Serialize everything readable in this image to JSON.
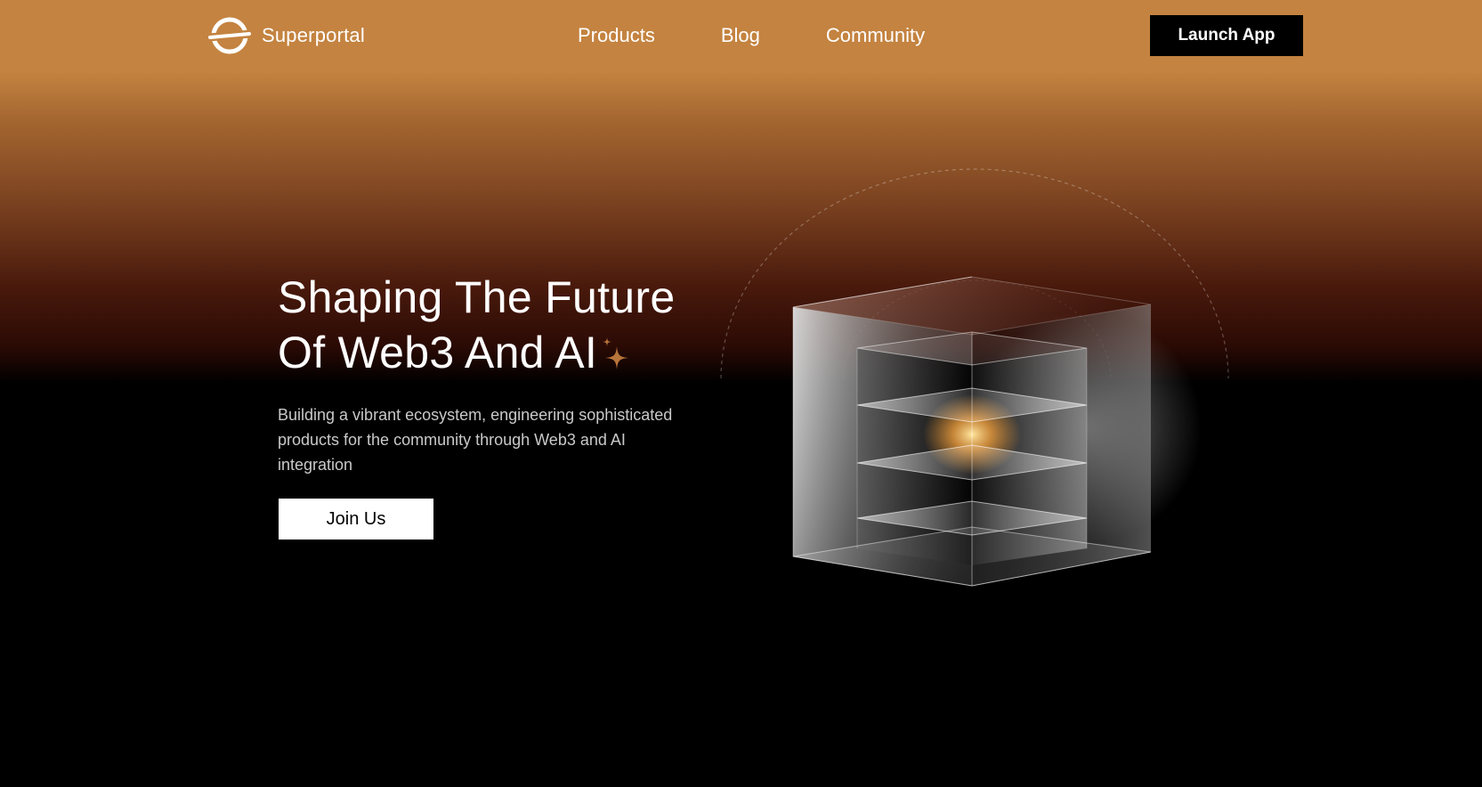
{
  "nav": {
    "brand": "Superportal",
    "links": [
      {
        "label": "Products"
      },
      {
        "label": "Blog"
      },
      {
        "label": "Community"
      }
    ],
    "cta_label": "Launch App"
  },
  "hero": {
    "title_line1": "Shaping The Future",
    "title_line2": "Of Web3 And AI",
    "description": "Building a vibrant ecosystem, engineering sophisticated products for the community through Web3 and AI integration",
    "cta_label": "Join Us"
  },
  "icons": {
    "logo": "superportal-logo-icon",
    "sparkle": "sparkle-icon",
    "illustration": "glass-cube-illustration"
  },
  "colors": {
    "nav_bg": "#c48340",
    "accent": "#c48340",
    "hero_bg": "#000000",
    "primary_button_bg": "#000000",
    "secondary_button_bg": "#ffffff"
  }
}
